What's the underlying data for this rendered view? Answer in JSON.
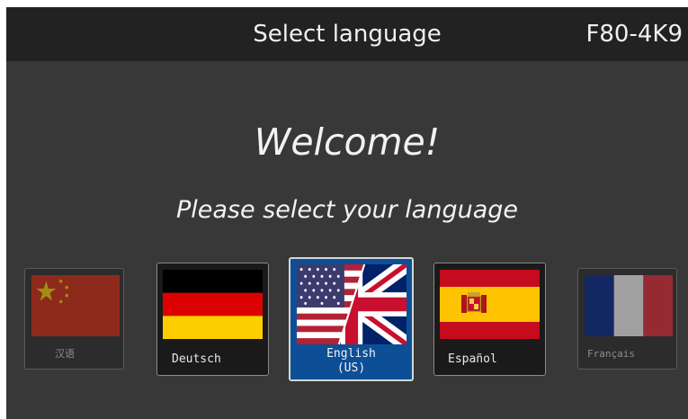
{
  "header": {
    "title": "Select language",
    "device_code": "F80-4K9"
  },
  "main": {
    "welcome": "Welcome!",
    "prompt": "Please select your language"
  },
  "languages": [
    {
      "label": "汉语",
      "flag": "china-flag-icon",
      "state": "dimmed"
    },
    {
      "label": "Deutsch",
      "flag": "germany-flag-icon",
      "state": "normal"
    },
    {
      "label": "English\n(US)",
      "flag": "us-uk-flag-icon",
      "state": "selected"
    },
    {
      "label": "Español",
      "flag": "spain-flag-icon",
      "state": "normal"
    },
    {
      "label": "Français",
      "flag": "france-flag-icon",
      "state": "dimmed"
    }
  ],
  "colors": {
    "background": "#383838",
    "header": "#222222",
    "selected": "#0d4f96",
    "text": "#f2f2f2"
  }
}
